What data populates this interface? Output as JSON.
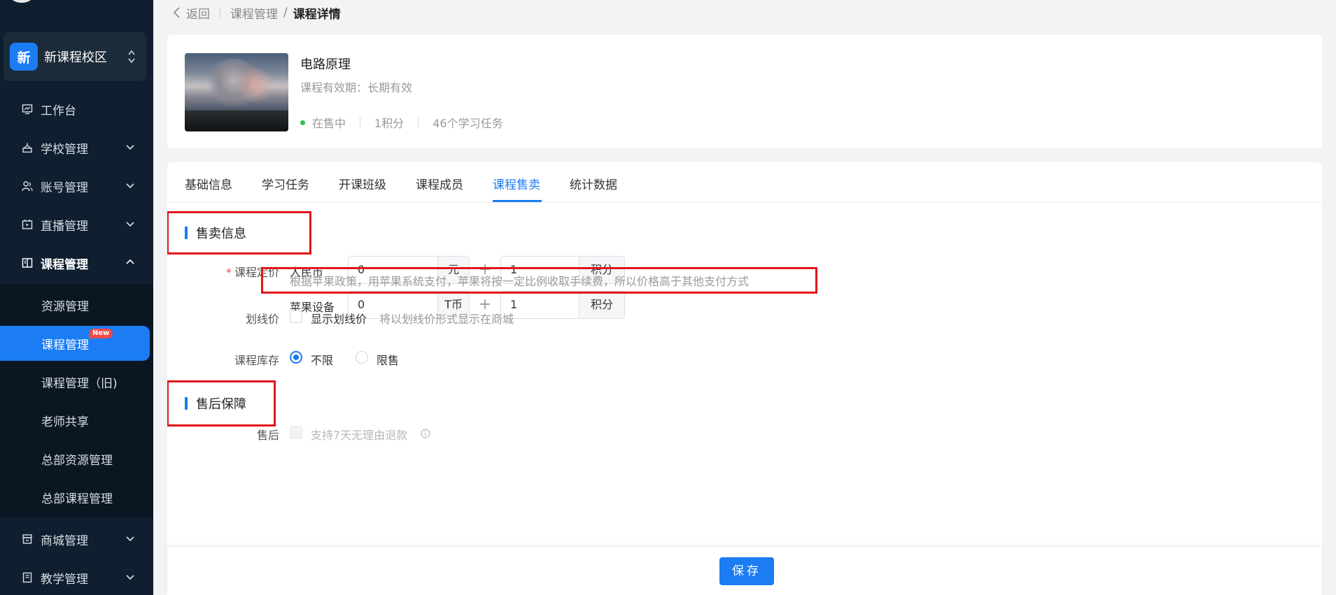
{
  "sidebar": {
    "campus": {
      "badge": "新",
      "name": "新课程校区"
    },
    "menu": [
      {
        "label": "工作台"
      },
      {
        "label": "学校管理"
      },
      {
        "label": "账号管理"
      },
      {
        "label": "直播管理"
      },
      {
        "label": "课程管理"
      }
    ],
    "submenu": [
      {
        "label": "资源管理"
      },
      {
        "label": "课程管理",
        "tag": "New"
      },
      {
        "label": "课程管理（旧)"
      },
      {
        "label": "老师共享"
      },
      {
        "label": "总部资源管理"
      },
      {
        "label": "总部课程管理"
      }
    ],
    "menu_bottom": [
      {
        "label": "商城管理"
      },
      {
        "label": "教学管理"
      }
    ]
  },
  "breadcrumb": {
    "back": "返回",
    "parent": "课程管理",
    "separator": "/",
    "current": "课程详情"
  },
  "course": {
    "title": "电路原理",
    "validity": "课程有效期：长期有效",
    "status": "在售中",
    "points": "1积分",
    "tasks": "46个学习任务"
  },
  "tabs": [
    {
      "label": "基础信息"
    },
    {
      "label": "学习任务"
    },
    {
      "label": "开课班级"
    },
    {
      "label": "课程成员"
    },
    {
      "label": "课程售卖",
      "active": true
    },
    {
      "label": "统计数据"
    }
  ],
  "sale_section": {
    "title": "售卖信息",
    "price_label": "课程定价",
    "rmb": {
      "label": "人民币",
      "amount": "0",
      "unit": "元",
      "points": "1",
      "points_unit": "积分"
    },
    "apple": {
      "label": "苹果设备",
      "amount": "0",
      "unit": "T币",
      "points": "1",
      "points_unit": "积分"
    },
    "apple_hint": "根据苹果政策，用苹果系统支付，苹果将按一定比例收取手续费，所以价格高于其他支付方式",
    "strike_label": "划线价",
    "strike_checkbox": "显示划线价",
    "strike_hint": "将以划线价形式显示在商城",
    "stock_label": "课程库存",
    "stock_options": [
      {
        "label": "不限",
        "selected": true
      },
      {
        "label": "限售",
        "selected": false
      }
    ]
  },
  "after_sale_section": {
    "title": "售后保障",
    "label": "售后",
    "refund_checkbox": "支持7天无理由退款"
  },
  "footer": {
    "save": "保存"
  },
  "colors": {
    "primary": "#1b7cf4",
    "sidebar": "#0f1f2f",
    "highlight_box": "#e0161b",
    "status_dot": "#2fbf4f"
  }
}
